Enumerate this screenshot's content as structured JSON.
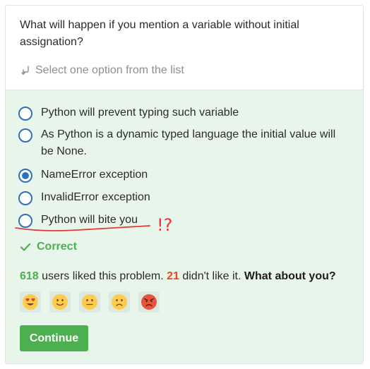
{
  "question": {
    "text": "What will happen if you mention a variable without initial assignation?"
  },
  "hint": {
    "icon": "arrow-turn-down-icon",
    "text": "Select one option from the list"
  },
  "options": [
    {
      "label": "Python will prevent typing such variable",
      "checked": false
    },
    {
      "label": "As Python is a dynamic typed language the initial value will be None.",
      "checked": false
    },
    {
      "label": "NameError exception",
      "checked": true
    },
    {
      "label": "InvalidError exception",
      "checked": false
    },
    {
      "label": "Python will bite you",
      "checked": false
    }
  ],
  "status": {
    "icon": "checkmark-icon",
    "text": "Correct",
    "color": "#4caf50"
  },
  "feedback": {
    "likes_count": "618",
    "likes_text": " users liked this problem. ",
    "dislikes_count": "21",
    "dislikes_text": " didn't like it. ",
    "question_text": "What about you?"
  },
  "reactions": [
    {
      "icon": "heart-eyes-face-icon"
    },
    {
      "icon": "smiling-face-icon"
    },
    {
      "icon": "neutral-face-icon"
    },
    {
      "icon": "slightly-frowning-face-icon"
    },
    {
      "icon": "angry-face-icon"
    }
  ],
  "continue_button": {
    "label": "Continue",
    "color": "#4caf50"
  },
  "annotation": {
    "text": "!?",
    "color": "#e53935"
  },
  "colors": {
    "accent": "#2f6fc2",
    "answer_background": "#e8f5ea",
    "likes": "#4caf50",
    "dislikes": "#e64a19"
  }
}
